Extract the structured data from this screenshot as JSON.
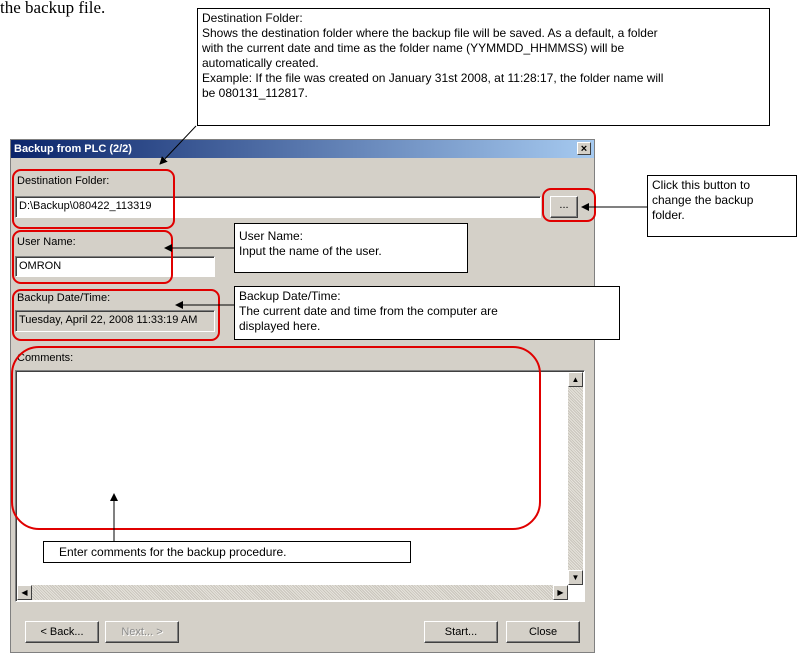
{
  "top_text": "the backup file.",
  "callouts": {
    "destination": {
      "title": "Destination Folder:",
      "line1": "Shows the destination folder where the backup file will be saved. As a default, a folder",
      "line2": "with the current date and time as the folder name (YYMMDD_HHMMSS) will be",
      "line3": "automatically created.",
      "line4": "Example: If the file was created on January 31st 2008, at 11:28:17, the folder name will",
      "line5": "be   080131_112817."
    },
    "browse": {
      "line1": "Click this button to",
      "line2": "change the backup",
      "line3": "folder."
    },
    "user_name": {
      "title": "User Name:",
      "line1": "Input the name of the user."
    },
    "backup_datetime": {
      "title": "Backup Date/Time:",
      "line1": "The current date and time from the computer are",
      "line2": "displayed here."
    },
    "comments": {
      "line1": "Enter comments for the backup procedure."
    }
  },
  "dialog": {
    "title": "Backup from PLC (2/2)",
    "close_label": "×",
    "destination_label": "Destination Folder:",
    "destination_value": "D:\\Backup\\080422_113319",
    "browse_label": "...",
    "user_name_label": "User Name:",
    "user_name_value": "OMRON",
    "backup_datetime_label": "Backup Date/Time:",
    "backup_datetime_value": "Tuesday, April 22, 2008 11:33:19 AM",
    "comments_label": "Comments:",
    "comments_value": "",
    "buttons": {
      "back": "< Back...",
      "next": "Next... >",
      "start": "Start...",
      "close": "Close"
    }
  },
  "colors": {
    "highlight": "#e00000",
    "titlebar_start": "#0a246a",
    "dialog_face": "#d4d0c8"
  }
}
